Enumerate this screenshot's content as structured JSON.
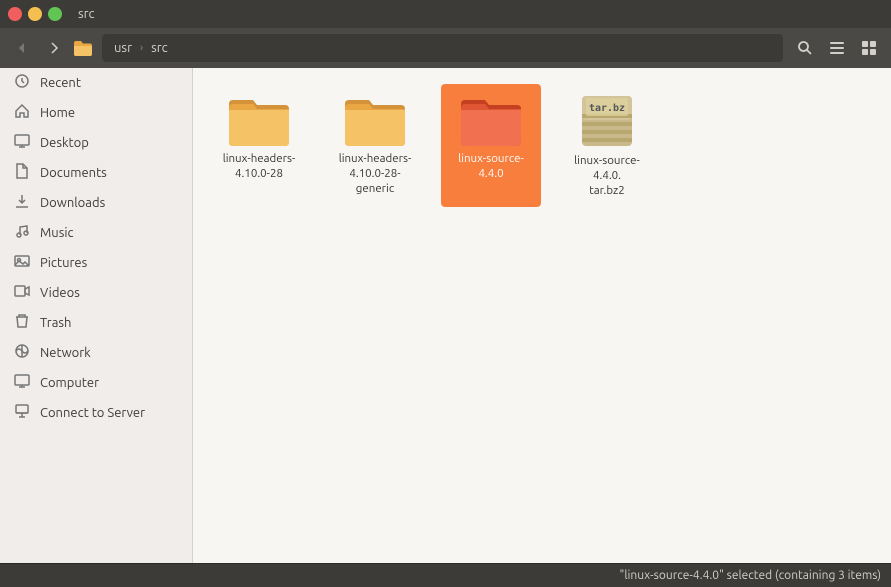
{
  "titlebar": {
    "title": "src"
  },
  "toolbar": {
    "back_btn": "‹",
    "forward_btn": "›",
    "folder_icon": "📁",
    "breadcrumb": [
      "usr",
      "src"
    ],
    "search_icon": "🔍",
    "list_view_icon": "☰",
    "grid_view_icon": "⋮⋮"
  },
  "sidebar": {
    "items": [
      {
        "id": "recent",
        "label": "Recent",
        "icon": "🕐"
      },
      {
        "id": "home",
        "label": "Home",
        "icon": "🏠"
      },
      {
        "id": "desktop",
        "label": "Desktop",
        "icon": "🖥"
      },
      {
        "id": "documents",
        "label": "Documents",
        "icon": "📄"
      },
      {
        "id": "downloads",
        "label": "Downloads",
        "icon": "⬇"
      },
      {
        "id": "music",
        "label": "Music",
        "icon": "🎵"
      },
      {
        "id": "pictures",
        "label": "Pictures",
        "icon": "📷"
      },
      {
        "id": "videos",
        "label": "Videos",
        "icon": "🎬"
      },
      {
        "id": "trash",
        "label": "Trash",
        "icon": "🗑"
      },
      {
        "id": "network",
        "label": "Network",
        "icon": "🌐"
      },
      {
        "id": "computer",
        "label": "Computer",
        "icon": "💻"
      },
      {
        "id": "connect-to-server",
        "label": "Connect to Server",
        "icon": "🔌"
      }
    ]
  },
  "files": [
    {
      "id": "linux-headers-428",
      "name": "linux-headers-\n4.10.0-28",
      "type": "folder",
      "color": "orange",
      "selected": false
    },
    {
      "id": "linux-headers-428g",
      "name": "linux-headers-\n4.10.0-28-generic",
      "type": "folder",
      "color": "orange",
      "selected": false
    },
    {
      "id": "linux-source-440",
      "name": "linux-source-4.4.0",
      "type": "folder",
      "color": "red",
      "selected": true
    },
    {
      "id": "linux-source-440-tar",
      "name": "linux-source-4.4.0.\ntar.bz2",
      "type": "tarbz2",
      "color": "tan",
      "selected": false
    }
  ],
  "statusbar": {
    "text": "\"linux-source-4.4.0\" selected (containing 3 items)"
  }
}
